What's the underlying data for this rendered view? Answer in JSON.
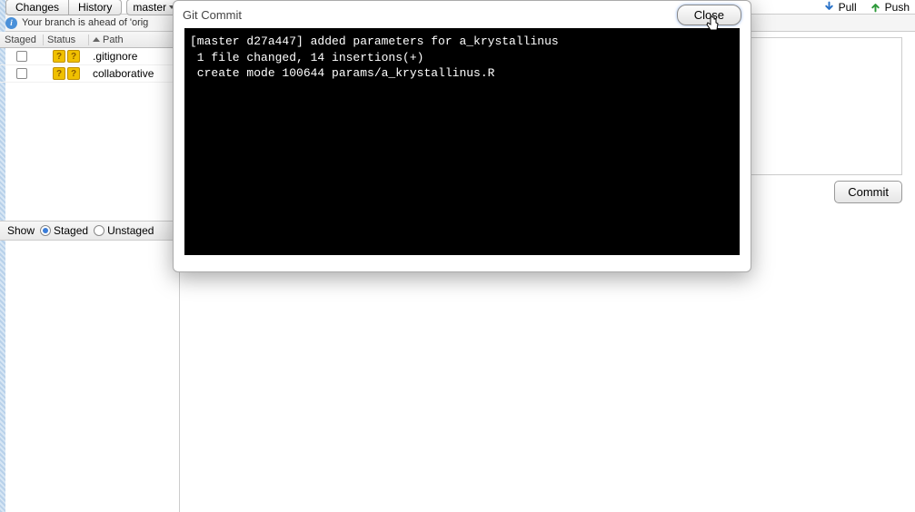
{
  "toolbar": {
    "changes_tab": "Changes",
    "history_tab": "History",
    "branch": "master",
    "pull_label": "Pull",
    "push_label": "Push"
  },
  "info_bar": {
    "message": "Your branch is ahead of 'orig"
  },
  "file_list": {
    "columns": {
      "staged": "Staged",
      "status": "Status",
      "path": "Path"
    },
    "rows": [
      {
        "path": ".gitignore",
        "status": "??"
      },
      {
        "path": "collaborative",
        "status": "??"
      }
    ]
  },
  "show_bar": {
    "label": "Show",
    "staged": "Staged",
    "unstaged": "Unstaged"
  },
  "commit": {
    "button": "Commit"
  },
  "modal": {
    "title": "Git Commit",
    "close": "Close",
    "terminal_lines": [
      "[master d27a447] added parameters for a_krystallinus",
      " 1 file changed, 14 insertions(+)",
      " create mode 100644 params/a_krystallinus.R"
    ]
  }
}
